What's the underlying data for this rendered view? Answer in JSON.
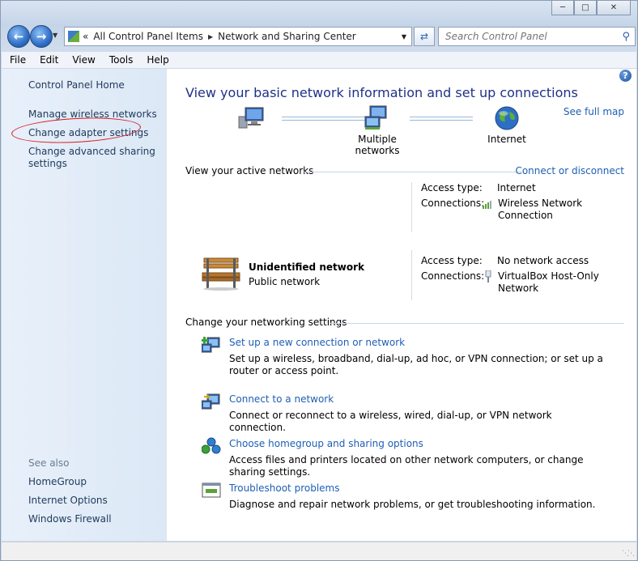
{
  "window": {
    "caption_buttons": [
      "minimize-icon",
      "maximize-icon",
      "close-icon"
    ]
  },
  "address_bar": {
    "overflow": "«",
    "crumbs": [
      "All Control Panel Items",
      "Network and Sharing Center"
    ],
    "search_placeholder": "Search Control Panel"
  },
  "menu": [
    "File",
    "Edit",
    "View",
    "Tools",
    "Help"
  ],
  "left_pane": {
    "links": [
      "Control Panel Home",
      "Manage wireless networks",
      "Change adapter settings",
      "Change advanced sharing settings"
    ],
    "see_also_label": "See also",
    "see_also": [
      "HomeGroup",
      "Internet Options",
      "Windows Firewall"
    ]
  },
  "main": {
    "title": "View your basic network information and set up connections",
    "see_full_map": "See full map",
    "map_nodes": [
      "",
      "Multiple networks",
      "Internet"
    ],
    "active_networks": {
      "heading": "View your active networks",
      "connect_link": "Connect or disconnect",
      "networks": [
        {
          "name": "",
          "category": "",
          "access_type_label": "Access type:",
          "access_type": "Internet",
          "connections_label": "Connections:",
          "connection": [
            "Wireless Network",
            "Connection"
          ]
        },
        {
          "name": "Unidentified network",
          "category": "Public network",
          "access_type_label": "Access type:",
          "access_type": "No network access",
          "connections_label": "Connections:",
          "connection": [
            "VirtualBox Host-Only",
            "Network"
          ]
        }
      ]
    },
    "settings": {
      "heading": "Change your networking settings",
      "tasks": [
        {
          "title": "Set up a new connection or network",
          "desc": "Set up a wireless, broadband, dial-up, ad hoc, or VPN connection; or set up a router or access point."
        },
        {
          "title": "Connect to a network",
          "desc": "Connect or reconnect to a wireless, wired, dial-up, or VPN network connection."
        },
        {
          "title": "Choose homegroup and sharing options",
          "desc": "Access files and printers located on other network computers, or change sharing settings."
        },
        {
          "title": "Troubleshoot problems",
          "desc": "Diagnose and repair network problems, or get troubleshooting information."
        }
      ]
    }
  }
}
